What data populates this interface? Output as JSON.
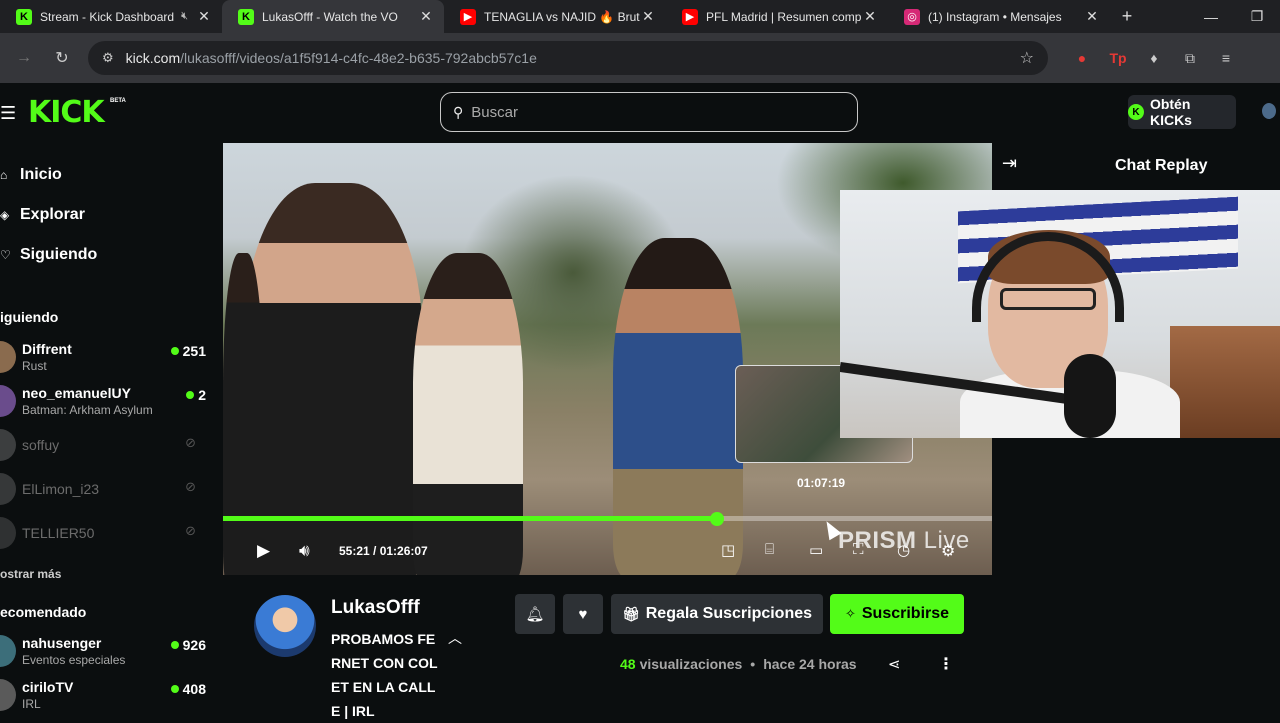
{
  "browser": {
    "tabs": [
      {
        "title": "Stream - Kick Dashboard",
        "fav_color": "#53fc18",
        "fav_glyph": "K",
        "muted": true,
        "active": false
      },
      {
        "title": "LukasOfff - Watch the VO",
        "fav_color": "#53fc18",
        "fav_glyph": "K",
        "muted": false,
        "active": true
      },
      {
        "title": "TENAGLIA vs NAJID 🔥 Brut",
        "fav_color": "#ff0000",
        "fav_glyph": "▶",
        "muted": false,
        "active": false
      },
      {
        "title": "PFL Madrid | Resumen comp",
        "fav_color": "#ff0000",
        "fav_glyph": "▶",
        "muted": false,
        "active": false
      },
      {
        "title": "(1) Instagram • Mensajes",
        "fav_color": "#d62976",
        "fav_glyph": "◎",
        "muted": false,
        "active": false
      }
    ],
    "url_host": "kick.com",
    "url_path": "/lukasofff/videos/a1f5f914-c4fc-48e2-b635-792abcb57c1e"
  },
  "kick": {
    "logo": "KICK",
    "beta": "BETA",
    "search_placeholder": "Buscar",
    "get_kicks": "Obtén KICKs"
  },
  "sidebar": {
    "nav": [
      {
        "label": "Inicio",
        "icon": "home-icon"
      },
      {
        "label": "Explorar",
        "icon": "compass-icon"
      },
      {
        "label": "Siguiendo",
        "icon": "heart-icon"
      }
    ],
    "following_title": "iguiendo",
    "following": [
      {
        "name": "Diffrent",
        "category": "Rust",
        "viewers": "251",
        "live": true,
        "avatar": "#8a6b4e"
      },
      {
        "name": "neo_emanuelUY",
        "category": "Batman: Arkham Asylum",
        "viewers": "2",
        "live": true,
        "avatar": "#6a4c8c"
      },
      {
        "name": "soffuy",
        "category": "",
        "viewers": "",
        "live": false,
        "avatar": "#888888"
      },
      {
        "name": "ElLimon_i23",
        "category": "",
        "viewers": "",
        "live": false,
        "avatar": "#777777"
      },
      {
        "name": "TELLIER50",
        "category": "",
        "viewers": "",
        "live": false,
        "avatar": "#666666"
      }
    ],
    "show_more": "ostrar más",
    "recommended_title": "ecomendado",
    "recommended": [
      {
        "name": "nahusenger",
        "category": "Eventos especiales",
        "viewers": "926",
        "live": true,
        "avatar": "#3c6e7a"
      },
      {
        "name": "ciriloTV",
        "category": "IRL",
        "viewers": "408",
        "live": true,
        "avatar": "#5a5a5a"
      }
    ]
  },
  "player": {
    "current": "55:21",
    "total": "01:26:07",
    "time_display": "55:21 / 01:26:07",
    "hover_time": "01:07:19",
    "progress": 0.643,
    "watermark_a": "PRISM",
    "watermark_b": " Live"
  },
  "chat": {
    "title": "Chat Replay"
  },
  "video_info": {
    "channel": "LukasOfff",
    "title": "PROBAMOS FERNET CON COLET EN LA CALLE | IRL",
    "gift_label": "Regala Suscripciones",
    "subscribe_label": "Suscribirse",
    "views": "48",
    "views_label": "visualizaciones",
    "age": "hace 24 horas"
  },
  "colors": {
    "accent": "#53fc18",
    "bg": "#0b0e0f"
  }
}
